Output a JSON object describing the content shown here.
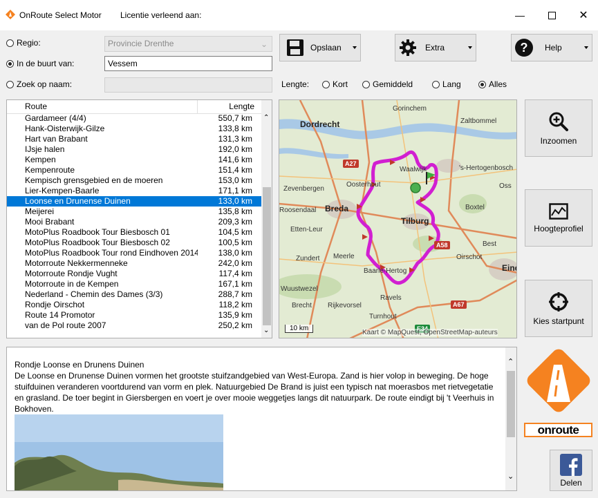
{
  "window": {
    "title": "OnRoute Select Motor",
    "license_label": "Licentie verleend aan:"
  },
  "filters": {
    "regio_label": "Regio:",
    "regio_value": "Provincie Drenthe",
    "nearby_label": "In de buurt van:",
    "nearby_value": "Vessem",
    "byname_label": "Zoek op naam:",
    "byname_value": ""
  },
  "toolbar": {
    "save_label": "Opslaan",
    "extra_label": "Extra",
    "help_label": "Help"
  },
  "length": {
    "label": "Lengte:",
    "options": [
      "Kort",
      "Gemiddeld",
      "Lang",
      "Alles"
    ],
    "selected": "Alles"
  },
  "list": {
    "col_route": "Route",
    "col_length": "Lengte",
    "rows": [
      {
        "name": "Gardameer (4/4)",
        "length": "550,7 km"
      },
      {
        "name": "Hank-Oisterwijk-Gilze",
        "length": "133,8 km"
      },
      {
        "name": "Hart van Brabant",
        "length": "131,3 km"
      },
      {
        "name": "IJsje halen",
        "length": "192,0 km"
      },
      {
        "name": "Kempen",
        "length": "141,6 km"
      },
      {
        "name": "Kempenroute",
        "length": "151,4 km"
      },
      {
        "name": "Kempisch grensgebied en de moeren",
        "length": "153,0 km"
      },
      {
        "name": "Lier-Kempen-Baarle",
        "length": "171,1 km"
      },
      {
        "name": "Loonse en Drunense Duinen",
        "length": "133,0 km"
      },
      {
        "name": "Meijerei",
        "length": "135,8 km"
      },
      {
        "name": "Mooi Brabant",
        "length": "209,3 km"
      },
      {
        "name": "MotoPlus Roadbook Tour Biesbosch 01",
        "length": "104,5 km"
      },
      {
        "name": "MotoPlus Roadbook Tour Biesbosch 02",
        "length": "100,5 km"
      },
      {
        "name": "MotoPlus Roadbook Tour rond Eindhoven 2014",
        "length": "138,0 km"
      },
      {
        "name": "Motorroute Nekkermenneke",
        "length": "242,0 km"
      },
      {
        "name": "Motorroute Rondje Vught",
        "length": "117,4 km"
      },
      {
        "name": "Motorroute in de Kempen",
        "length": "167,1 km"
      },
      {
        "name": "Nederland - Chemin des Dames (3/3)",
        "length": "288,7 km"
      },
      {
        "name": "Rondje Oirschot",
        "length": "118,2 km"
      },
      {
        "name": "Route 14 Promotor",
        "length": "135,9 km"
      },
      {
        "name": "van de Pol route 2007",
        "length": "250,2 km"
      }
    ],
    "selected_index": 8
  },
  "map": {
    "labels": [
      "Gorinchem",
      "Dordrecht",
      "Zaltbommel",
      "Waalwijk",
      "'s-Hertogenbosch",
      "Zevenbergen",
      "Oosterhout",
      "Breda",
      "Tilburg",
      "Boxtel",
      "Roosendaal",
      "Oss",
      "Etten-Leur",
      "Best",
      "Zundert",
      "Meerle",
      "Baarle-Hertog",
      "Oirschot",
      "Wuustwezel",
      "Brecht",
      "Rijkevorsel",
      "Ravels",
      "Turnhout",
      "Eindhoven"
    ],
    "roads": [
      "A27",
      "A58",
      "A67",
      "E34"
    ],
    "scale": "10 km",
    "attribution": "Kaart © MapQuest, OpenStreetMap-auteurs"
  },
  "side": {
    "zoom_label": "Inzoomen",
    "profile_label": "Hoogteprofiel",
    "start_label": "Kies startpunt",
    "share_label": "Delen"
  },
  "brand": {
    "logo_text": "onroute"
  },
  "description": {
    "title": "Rondje Loonse en Drunens Duinen",
    "body": "De Loonse en Drunense Duinen vormen het grootste stuifzandgebied van West-Europa. Zand is hier volop in beweging. De hoge stuifduinen veranderen voortdurend van vorm en plek. Natuurgebied De Brand is juist een typisch nat moerasbos met rietvegetatie en grasland. De toer begint in Giersbergen en voert je over mooie weggetjes langs dit natuurpark. De route eindigt bij 't Veerhuis in Bokhoven."
  },
  "colors": {
    "selection": "#0078d7",
    "route": "#d11fd1",
    "accent": "#f58220"
  }
}
